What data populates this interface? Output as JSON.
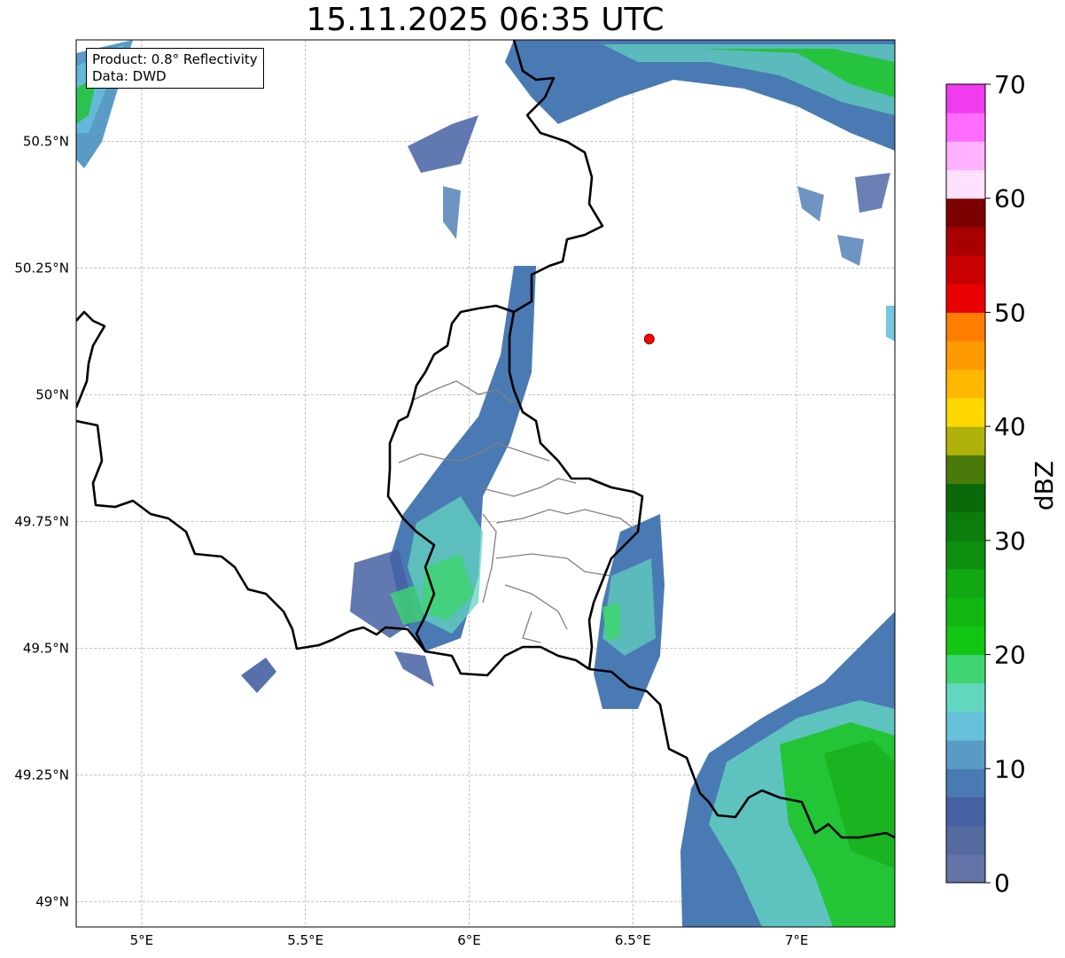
{
  "title": "15.11.2025 06:35 UTC",
  "info": {
    "product": "Product: 0.8° Reflectivity",
    "data": "Data: DWD"
  },
  "map": {
    "extent": {
      "lon_min": 4.8,
      "lon_max": 7.3,
      "lat_min": 48.95,
      "lat_max": 50.7
    },
    "lon_ticks": [
      {
        "value": 5.0,
        "label": "5°E"
      },
      {
        "value": 5.5,
        "label": "5.5°E"
      },
      {
        "value": 6.0,
        "label": "6°E"
      },
      {
        "value": 6.5,
        "label": "6.5°E"
      },
      {
        "value": 7.0,
        "label": "7°E"
      }
    ],
    "lat_ticks": [
      {
        "value": 50.5,
        "label": "50.5°N"
      },
      {
        "value": 50.25,
        "label": "50.25°N"
      },
      {
        "value": 50.0,
        "label": "50°N"
      },
      {
        "value": 49.75,
        "label": "49.75°N"
      },
      {
        "value": 49.5,
        "label": "49.5°N"
      },
      {
        "value": 49.25,
        "label": "49.25°N"
      },
      {
        "value": 49.0,
        "label": "49°N"
      }
    ],
    "radar_site": {
      "lon": 6.55,
      "lat": 50.11,
      "color": "#ff0000"
    },
    "grid_color": "#b0b0b0"
  },
  "colorbar": {
    "label": "dBZ",
    "min": 0,
    "max": 70,
    "tick_values": [
      0,
      10,
      20,
      30,
      40,
      50,
      60,
      70
    ],
    "tick_labels": [
      "0",
      "10",
      "20",
      "30",
      "40",
      "50",
      "60",
      "70"
    ],
    "colors": [
      "#6474a8",
      "#556a9e",
      "#4560a3",
      "#4a7ab3",
      "#5a9bc6",
      "#67c1dd",
      "#63d6c0",
      "#3fd572",
      "#14c614",
      "#12b812",
      "#12a812",
      "#0e8e0e",
      "#0c7c0c",
      "#0a6a0a",
      "#4a7a0a",
      "#aeb20a",
      "#ffd800",
      "#ffb800",
      "#ff9b00",
      "#ff7e00",
      "#e80000",
      "#c80000",
      "#a80000",
      "#7c0000",
      "#ffe0ff",
      "#ffb2ff",
      "#ff6cff",
      "#ee3cee"
    ]
  },
  "legend_colors": {
    "border": "#000000",
    "admin_border": "#808080"
  }
}
